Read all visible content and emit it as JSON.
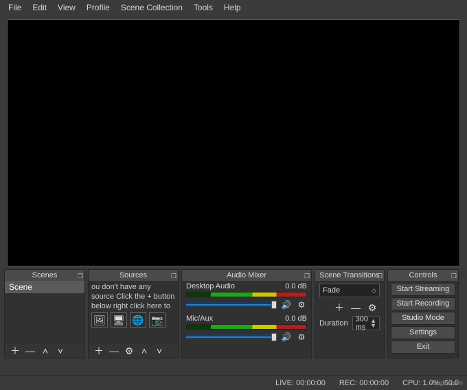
{
  "menu": {
    "file": "File",
    "edit": "Edit",
    "view": "View",
    "profile": "Profile",
    "scene_collection": "Scene Collection",
    "tools": "Tools",
    "help": "Help"
  },
  "panels": {
    "scenes": {
      "title": "Scenes",
      "items": [
        "Scene"
      ]
    },
    "sources": {
      "title": "Sources",
      "hint": "ou don't have any source\nClick the + button below\nright click here to add o"
    },
    "mixer": {
      "title": "Audio Mixer",
      "channels": [
        {
          "name": "Desktop Audio",
          "level": "0.0 dB"
        },
        {
          "name": "Mic/Aux",
          "level": "0.0 dB"
        }
      ]
    },
    "transitions": {
      "title": "Scene Transitions",
      "selected": "Fade",
      "duration_label": "Duration",
      "duration_value": "300 ms"
    },
    "controls": {
      "title": "Controls",
      "buttons": {
        "start_streaming": "Start Streaming",
        "start_recording": "Start Recording",
        "studio_mode": "Studio Mode",
        "settings": "Settings",
        "exit": "Exit"
      }
    }
  },
  "status": {
    "live": "LIVE: 00:00:00",
    "rec": "REC: 00:00:00",
    "cpu": "CPU: 1.0%, 60.0"
  },
  "watermark": "7svdn.com",
  "glyphs": {
    "plus": "＋",
    "minus": "—",
    "up": "˄",
    "down": "˅",
    "gear": "⚙",
    "speaker": "🔊",
    "caret": "◇",
    "popout": "❐",
    "image": "🖼",
    "monitor": "🖥",
    "globe": "🌐",
    "camera": "📷",
    "spinup": "▲",
    "spindown": "▼"
  }
}
